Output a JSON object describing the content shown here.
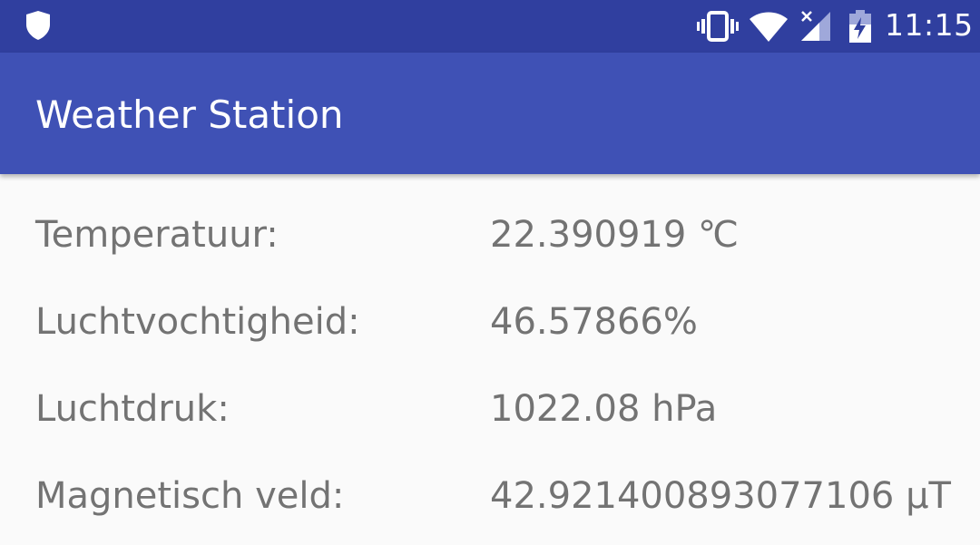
{
  "status_bar": {
    "time": "11:15",
    "icons": [
      "shield-icon",
      "vibrate-icon",
      "wifi-icon",
      "no-signal-icon",
      "battery-charging-icon"
    ],
    "background_color": "#303f9f"
  },
  "app_bar": {
    "title": "Weather Station",
    "background_color": "#3f51b5"
  },
  "readings": [
    {
      "label": "Temperatuur:",
      "value": "22.390919 ℃"
    },
    {
      "label": "Luchtvochtigheid:",
      "value": "46.57866%"
    },
    {
      "label": "Luchtdruk:",
      "value": "1022.08 hPa"
    },
    {
      "label": "Magnetisch veld:",
      "value": "42.921400893077106 µT"
    }
  ],
  "colors": {
    "text_secondary": "#737373",
    "background": "#fafafa"
  }
}
